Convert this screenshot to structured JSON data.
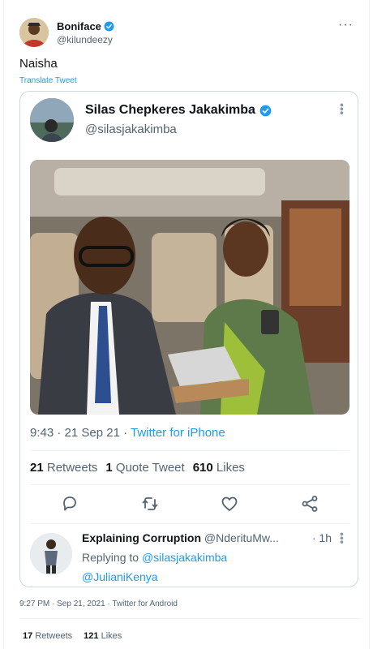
{
  "outer": {
    "name": "Boniface",
    "handle": "@kilundeezy",
    "text": "Naisha",
    "translate_label": "Translate Tweet",
    "more": "···"
  },
  "quoted": {
    "name": "Silas Chepkeres Jakakimba",
    "handle": "@silasjakakimba",
    "time": "9:43 · 21 Sep 21 ·",
    "source": "Twitter for iPhone",
    "retweets_count": "21",
    "retweets_label": "Retweets",
    "quotes_count": "1",
    "quotes_label": "Quote Tweet",
    "likes_count": "610",
    "likes_label": "Likes",
    "reply": {
      "name": "Explaining Corruption",
      "handle": "@NderituMw...",
      "time": "· 1h",
      "replying_to": "Replying to",
      "mention1": "@silasjakakimba",
      "mention2": "@JulianiKenya"
    }
  },
  "footer": {
    "timestamp": "9:27 PM · Sep 21, 2021 · Twitter for Android",
    "retweets_count": "17",
    "retweets_label": "Retweets",
    "likes_count": "121",
    "likes_label": "Likes"
  },
  "colors": {
    "accent": "#1d9bf0",
    "secondary_text": "#536471",
    "border": "#cfd9de"
  },
  "icons": [
    "verified-badge-icon",
    "reply-icon",
    "retweet-icon",
    "like-icon",
    "share-icon",
    "more-icon"
  ]
}
